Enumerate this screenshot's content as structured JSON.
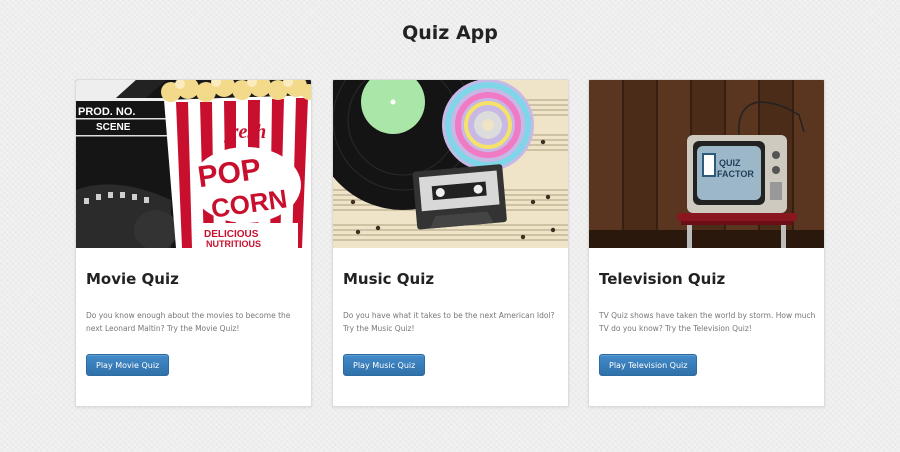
{
  "page": {
    "title": "Quiz App"
  },
  "cards": [
    {
      "title": "Movie Quiz",
      "description": "Do you know enough about the movies to become the next Leonard Maltin? Try the Movie Quiz!",
      "button_label": "Play Movie Quiz",
      "image_text": {
        "clapper_line1": "PROD. NO.",
        "clapper_line2": "SCENE",
        "fresh": "fresh",
        "pop": "POP",
        "corn": "CORN",
        "delicious": "DELICIOUS",
        "nutritious": "NUTRITIOUS"
      }
    },
    {
      "title": "Music Quiz",
      "description": "Do you have what it takes to be the next American Idol? Try the Music Quiz!",
      "button_label": "Play Music Quiz"
    },
    {
      "title": "Television Quiz",
      "description": "TV Quiz shows have taken the world by storm. How much TV do you know? Try the Television Quiz!",
      "button_label": "Play Television Quiz",
      "image_text": {
        "screen_line1": "QUIZ",
        "screen_line2": "FACTOR"
      }
    }
  ],
  "colors": {
    "button": "#3a7bbf",
    "popcorn_red": "#c8102e",
    "tv_wood": "#4a2c18"
  }
}
